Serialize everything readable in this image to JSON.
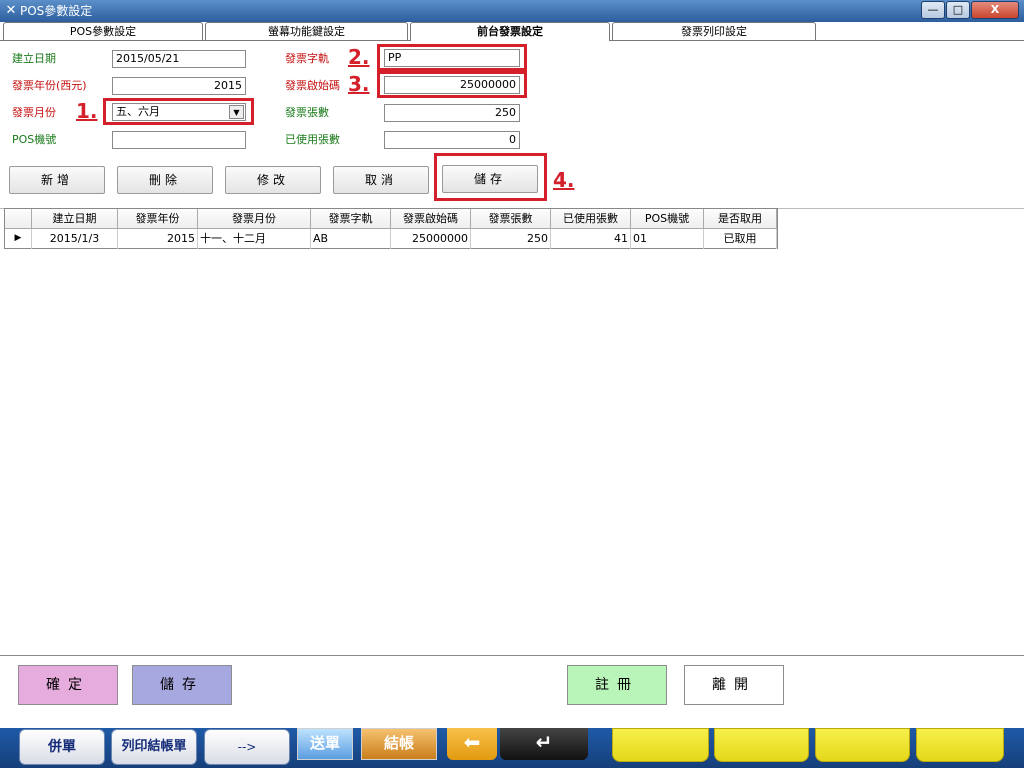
{
  "window": {
    "title": "POS參數設定",
    "controls": {
      "minimize": "—",
      "maximize": "□",
      "close": "X"
    }
  },
  "tabs": [
    {
      "label": "POS參數設定",
      "active": false
    },
    {
      "label": "螢幕功能鍵設定",
      "active": false
    },
    {
      "label": "前台發票設定",
      "active": true
    },
    {
      "label": "發票列印設定",
      "active": false
    }
  ],
  "form": {
    "created_date": {
      "label": "建立日期",
      "value": "2015/05/21"
    },
    "invoice_year": {
      "label": "發票年份(西元)",
      "value": "2015"
    },
    "invoice_month": {
      "label": "發票月份",
      "value": "五、六月"
    },
    "pos_machine": {
      "label": "POS機號",
      "value": ""
    },
    "invoice_track": {
      "label": "發票字軌",
      "value": "PP"
    },
    "invoice_start": {
      "label": "發票啟始碼",
      "value": "25000000"
    },
    "invoice_count": {
      "label": "發票張數",
      "value": "250"
    },
    "used_count": {
      "label": "已使用張數",
      "value": "0"
    }
  },
  "steps": [
    "1.",
    "2.",
    "3.",
    "4."
  ],
  "actions": {
    "add": "新增",
    "delete": "刪除",
    "edit": "修改",
    "cancel": "取消",
    "save": "儲存"
  },
  "table": {
    "columns": [
      "建立日期",
      "發票年份",
      "發票月份",
      "發票字軌",
      "發票啟始碼",
      "發票張數",
      "已使用張數",
      "POS機號",
      "是否取用"
    ],
    "rows": [
      {
        "marker": "▶",
        "cells": [
          "2015/1/3",
          "2015",
          "十一、十二月",
          "AB",
          "25000000",
          "250",
          "41",
          "01",
          "已取用"
        ]
      }
    ]
  },
  "footer": {
    "confirm": "確定",
    "save": "儲存",
    "register": "註冊",
    "leave": "離開"
  },
  "taskbar": {
    "merge": "併單",
    "print_checkout": "列印結帳單",
    "next": "-->",
    "send": "送單",
    "checkout": "結帳",
    "back_arrow": "⬅",
    "enter_arrow": "↵"
  },
  "colors": {
    "highlight": "#d4202a",
    "confirm_bg": "#e7acde",
    "save_bg": "#a8a8e0",
    "register_bg": "#b9f5b9",
    "taskbar_bg": "#1f5aa8",
    "yellow_key": "#ede43a"
  }
}
